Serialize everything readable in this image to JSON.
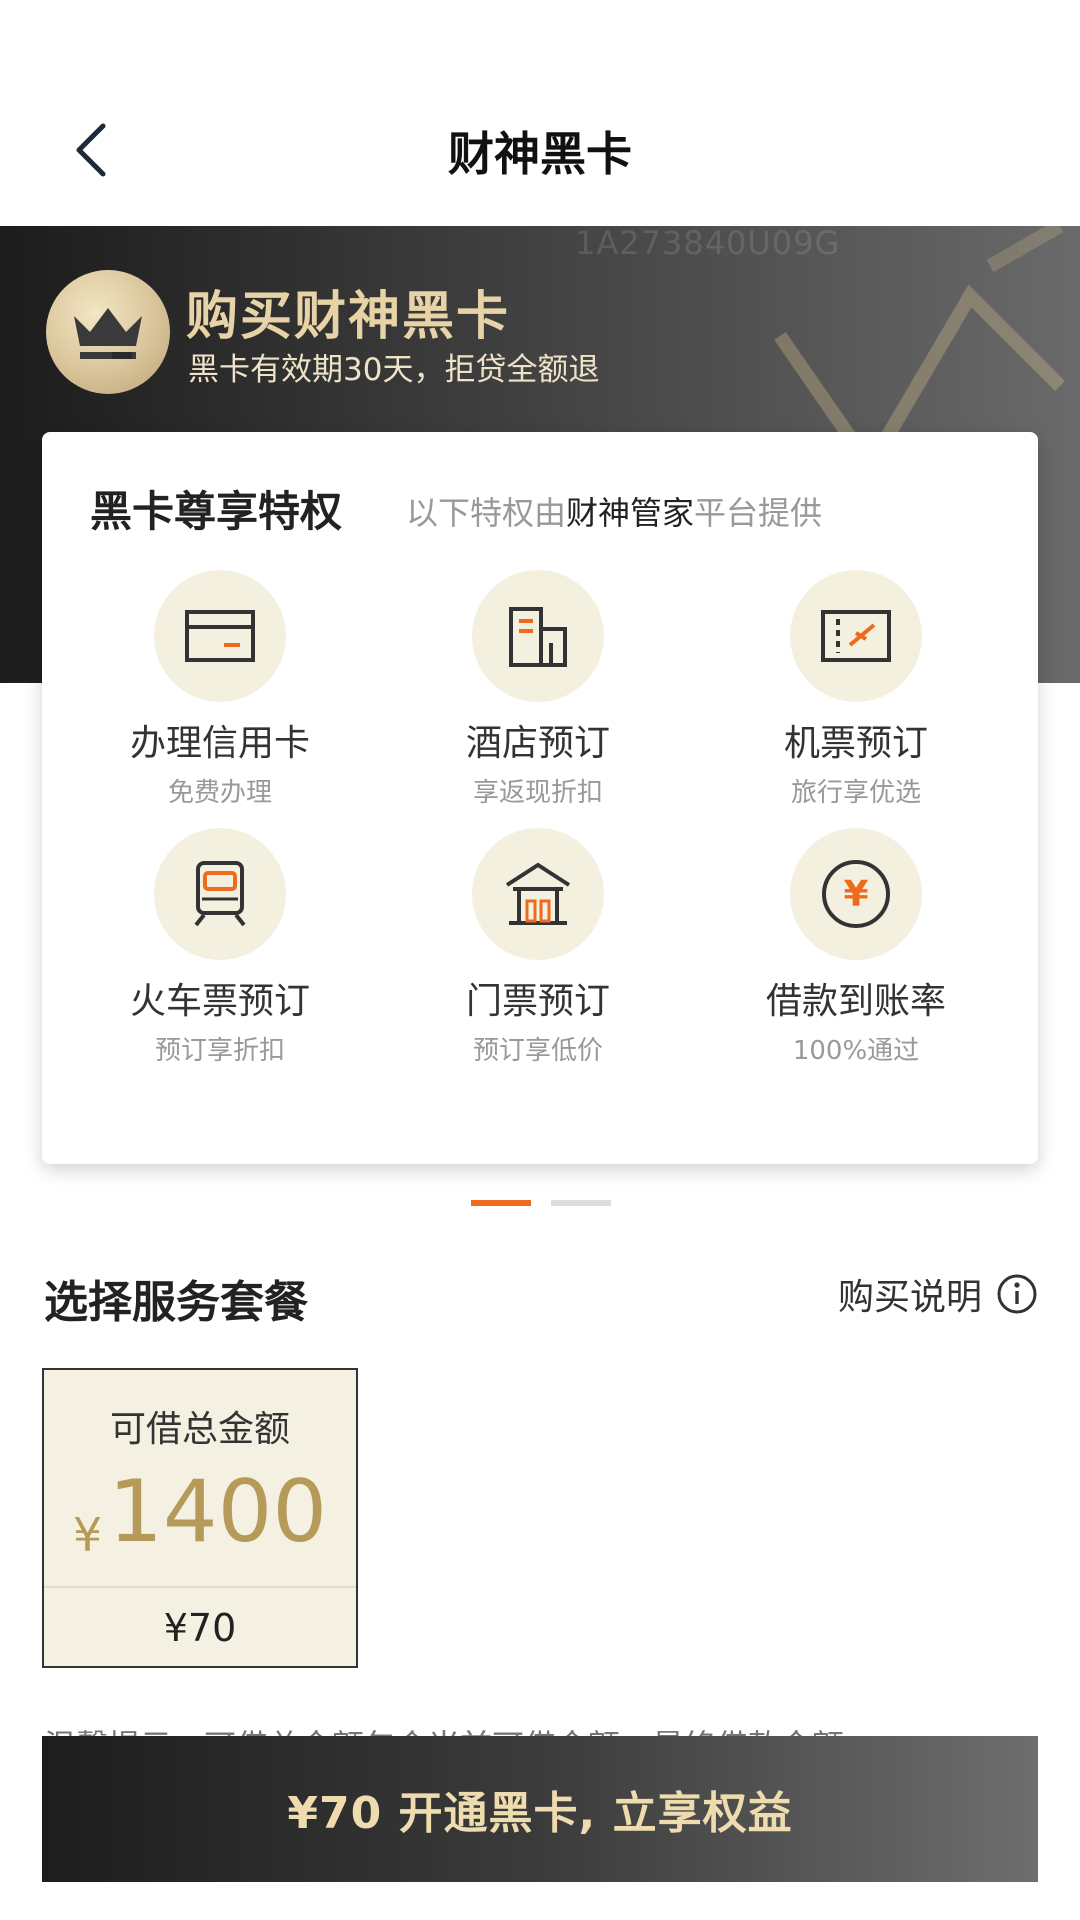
{
  "header": {
    "title": "财神黑卡"
  },
  "banner": {
    "code": "1A273840U09G",
    "title": "购买财神黑卡",
    "subtitle": "黑卡有效期30天，拒贷全额退"
  },
  "privileges": {
    "heading": "黑卡尊享特权",
    "subtitle_pre": "以下特权由",
    "subtitle_highlight": "财神管家",
    "subtitle_post": "平台提供",
    "items": [
      {
        "label": "办理信用卡",
        "desc": "免费办理",
        "icon": "credit-card-icon"
      },
      {
        "label": "酒店预订",
        "desc": "享返现折扣",
        "icon": "hotel-icon"
      },
      {
        "label": "机票预订",
        "desc": "旅行享优选",
        "icon": "flight-ticket-icon"
      },
      {
        "label": "火车票预订",
        "desc": "预订享折扣",
        "icon": "train-icon"
      },
      {
        "label": "门票预订",
        "desc": "预订享低价",
        "icon": "pavilion-icon"
      },
      {
        "label": "借款到账率",
        "desc": "100%通过",
        "icon": "yuan-coin-icon"
      }
    ]
  },
  "pager": {
    "current": 1,
    "total": 2
  },
  "packages": {
    "section_title": "选择服务套餐",
    "info_label": "购买说明",
    "items": [
      {
        "label": "可借总金额",
        "currency": "¥",
        "amount": "1400",
        "price": "¥70"
      }
    ]
  },
  "tip": "温馨提示：可借总金额包含当前可借金额，最终借款金额",
  "cta": {
    "label": "¥70 开通黑卡, 立享权益"
  },
  "colors": {
    "accent_orange": "#f06a1e",
    "gold": "#b59a5a",
    "banner_dark": "#1c1c1c"
  }
}
